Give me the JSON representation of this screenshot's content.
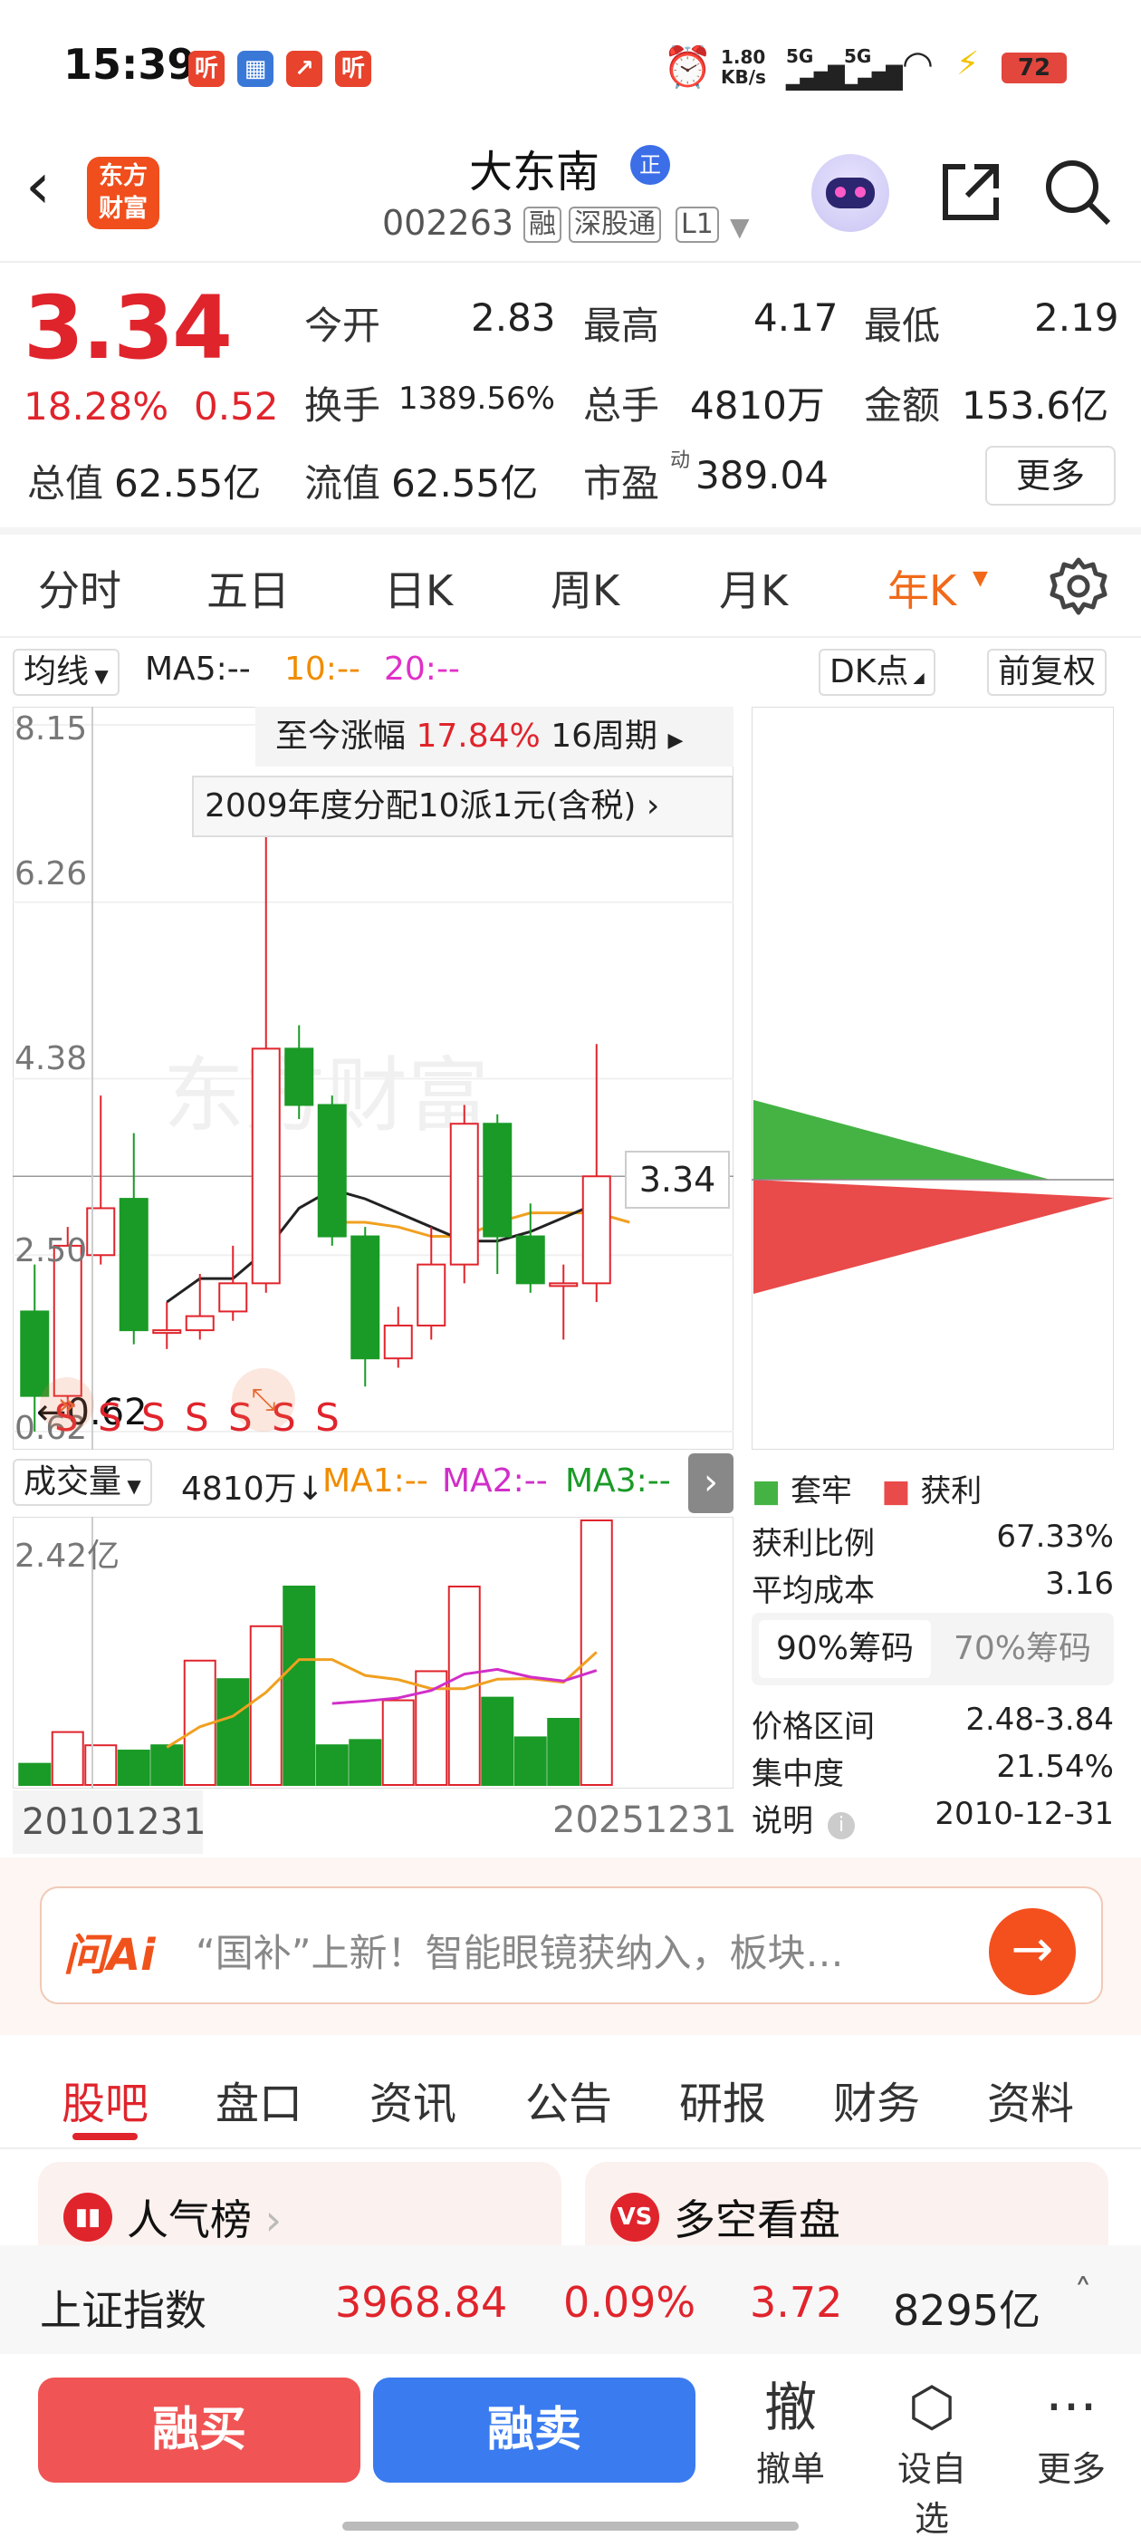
{
  "status_bar": {
    "time": "15:39",
    "net_speed_top": "1.80",
    "net_speed_unit": "KB/s",
    "signal1": "5G",
    "signal2": "5G",
    "battery": "72",
    "badge1": "听",
    "badge4": "听"
  },
  "header": {
    "logo_line1": "东方",
    "logo_line2": "财富",
    "stock_name": "大东南",
    "zheng_badge": "正",
    "stock_code": "002263",
    "tag_rong": "融",
    "tag_sgt": "深股通",
    "tag_level": "L1"
  },
  "quote": {
    "price": "3.34",
    "change_pct": "18.28%",
    "change_amt": "0.52",
    "open_label": "今开",
    "open_value": "2.83",
    "high_label": "最高",
    "high_value": "4.17",
    "low_label": "最低",
    "low_value": "2.19",
    "turnover_label": "换手",
    "turnover_value": "1389.56%",
    "volume_label": "总手",
    "volume_value": "4810万",
    "amount_label": "金额",
    "amount_value": "153.6亿",
    "mktcap_label": "总值",
    "mktcap_value": "62.55亿",
    "float_label": "流值",
    "float_value": "62.55亿",
    "pe_label": "市盈",
    "pe_sup": "动",
    "pe_value": "389.04",
    "more_label": "更多"
  },
  "period_tabs": [
    "分时",
    "五日",
    "日K",
    "周K",
    "月K",
    "年K"
  ],
  "chart_toolbar": {
    "ma_select": "均线",
    "ma5": "MA5:--",
    "ma10": "10:--",
    "ma20": "20:--",
    "dk_label": "DK点",
    "fq_label": "前复权"
  },
  "kline_overlay": {
    "gain_label": "至今涨幅",
    "gain_value": "17.84%",
    "periods": "16周期",
    "dividend_note": "2009年度分配10派1元(含税)",
    "low_marker": "0.62",
    "price_tag": "3.34",
    "signals": "S S S S S S S",
    "watermark": "东方财富"
  },
  "chart_data": {
    "type": "candlestick",
    "x_start": "20101231",
    "x_end": "20251231",
    "y_ticks": [
      "8.15",
      "6.26",
      "4.38",
      "2.50",
      "0.62"
    ],
    "ylim": [
      0.62,
      8.15
    ],
    "candles": [
      {
        "o": 1.9,
        "c": 1.0,
        "h": 2.4,
        "l": 0.62
      },
      {
        "o": 1.0,
        "c": 2.6,
        "h": 2.8,
        "l": 0.8
      },
      {
        "o": 2.5,
        "c": 3.0,
        "h": 4.2,
        "l": 2.4
      },
      {
        "o": 3.1,
        "c": 1.7,
        "h": 3.8,
        "l": 1.55
      },
      {
        "o": 1.7,
        "c": 1.7,
        "h": 2.0,
        "l": 1.5
      },
      {
        "o": 1.7,
        "c": 1.85,
        "h": 2.3,
        "l": 1.6
      },
      {
        "o": 1.9,
        "c": 2.2,
        "h": 2.6,
        "l": 1.8
      },
      {
        "o": 2.2,
        "c": 4.7,
        "h": 7.2,
        "l": 2.1
      },
      {
        "o": 4.7,
        "c": 4.1,
        "h": 4.95,
        "l": 3.95
      },
      {
        "o": 4.1,
        "c": 2.7,
        "h": 4.2,
        "l": 2.6
      },
      {
        "o": 2.7,
        "c": 1.4,
        "h": 2.8,
        "l": 1.1
      },
      {
        "o": 1.4,
        "c": 1.75,
        "h": 1.95,
        "l": 1.3
      },
      {
        "o": 1.75,
        "c": 2.4,
        "h": 2.8,
        "l": 1.6
      },
      {
        "o": 2.4,
        "c": 3.9,
        "h": 4.1,
        "l": 2.2
      },
      {
        "o": 3.9,
        "c": 2.7,
        "h": 4.0,
        "l": 2.3
      },
      {
        "o": 2.7,
        "c": 2.2,
        "h": 3.05,
        "l": 2.1
      },
      {
        "o": 2.2,
        "c": 2.2,
        "h": 2.4,
        "l": 1.6
      },
      {
        "o": 2.2,
        "c": 3.34,
        "h": 4.75,
        "l": 2.0
      }
    ],
    "ma_line_black": [
      null,
      null,
      null,
      null,
      2.0,
      2.25,
      2.25,
      2.55,
      3.0,
      3.2,
      3.1,
      2.95,
      2.8,
      2.65,
      2.65,
      2.75,
      2.9,
      3.05
    ],
    "ma_line_orange": [
      null,
      null,
      null,
      null,
      null,
      null,
      null,
      null,
      null,
      2.85,
      2.85,
      2.8,
      2.7,
      2.7,
      2.85,
      2.95,
      2.95,
      2.95,
      2.85
    ]
  },
  "volume_panel": {
    "select": "成交量",
    "volume": "4810万",
    "arrow": "↓",
    "ma1": "MA1:--",
    "ma2": "MA2:--",
    "ma3": "MA3:--",
    "max_label": "2.42亿",
    "values": [
      0.08,
      0.2,
      0.15,
      0.13,
      0.15,
      0.47,
      0.4,
      0.6,
      0.75,
      0.15,
      0.17,
      0.32,
      0.43,
      0.75,
      0.33,
      0.18,
      0.25,
      1.0
    ],
    "colors": [
      "g",
      "r",
      "r",
      "g",
      "g",
      "r",
      "g",
      "r",
      "g",
      "g",
      "g",
      "r",
      "r",
      "r",
      "g",
      "g",
      "g",
      "r"
    ]
  },
  "chip_panel": {
    "legend_trapped": "套牢",
    "legend_profit": "获利",
    "profit_ratio_label": "获利比例",
    "profit_ratio_value": "67.33%",
    "avg_cost_label": "平均成本",
    "avg_cost_value": "3.16",
    "tab_90": "90%筹码",
    "tab_70": "70%筹码",
    "price_range_label": "价格区间",
    "price_range_value": "2.48-3.84",
    "concentration_label": "集中度",
    "concentration_value": "21.54%",
    "note_label": "说明",
    "note_value": "2010-12-31"
  },
  "ask_ai": {
    "brand": "问Ai",
    "hint": "“国补”上新！智能眼镜获纳入，板块…"
  },
  "content_tabs": [
    "股吧",
    "盘口",
    "资讯",
    "公告",
    "研报",
    "财务",
    "资料"
  ],
  "cards": {
    "left_title": "人气榜",
    "right_title": "多空看盘",
    "right_icon": "VS"
  },
  "index_bar": {
    "name": "上证指数",
    "value": "3968.84",
    "pct": "0.09%",
    "chg": "3.72",
    "amount": "8295亿"
  },
  "bottom_bar": {
    "buy": "融买",
    "sell": "融卖",
    "cancel_icon_char": "撤",
    "cancel": "撤单",
    "watch": "设自选",
    "more": "更多"
  },
  "colors": {
    "up": "#e0242c",
    "down": "#1a9a26",
    "accent": "#f06a1a",
    "buy_btn": "#f05454",
    "sell_btn": "#3a7bf0"
  }
}
